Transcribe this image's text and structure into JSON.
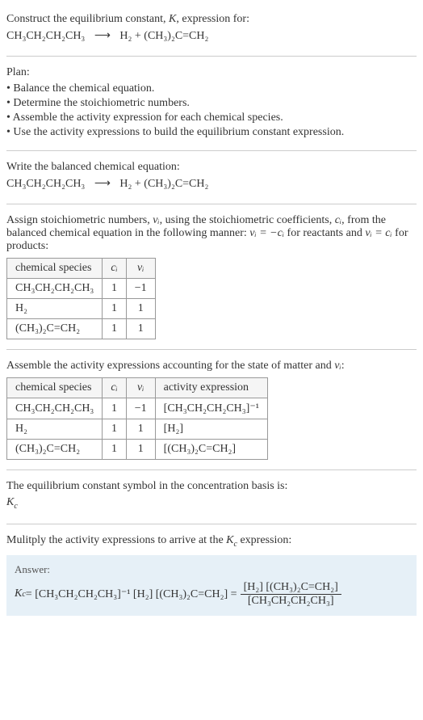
{
  "title_line1": "Construct the equilibrium constant, ",
  "title_K": "K",
  "title_line1_end": ", expression for:",
  "main_reaction_lhs": "CH₃CH₂CH₂CH₃",
  "arrow": "⟶",
  "main_reaction_rhs": "H₂ + (CH₃)₂C=CH₂",
  "plan_label": "Plan:",
  "plan_items": [
    "• Balance the chemical equation.",
    "• Determine the stoichiometric numbers.",
    "• Assemble the activity expression for each chemical species.",
    "• Use the activity expressions to build the equilibrium constant expression."
  ],
  "balanced_label": "Write the balanced chemical equation:",
  "stoich_text1": "Assign stoichiometric numbers, ",
  "nu_i": "νᵢ",
  "stoich_text2": ", using the stoichiometric coefficients, ",
  "c_i": "cᵢ",
  "stoich_text3": ", from the balanced chemical equation in the following manner: ",
  "stoich_rel1": "νᵢ = −cᵢ",
  "stoich_text4": " for reactants and ",
  "stoich_rel2": "νᵢ = cᵢ",
  "stoich_text5": " for products:",
  "table1_headers": [
    "chemical species",
    "cᵢ",
    "νᵢ"
  ],
  "table1_rows": [
    [
      "CH₃CH₂CH₂CH₃",
      "1",
      "−1"
    ],
    [
      "H₂",
      "1",
      "1"
    ],
    [
      "(CH₃)₂C=CH₂",
      "1",
      "1"
    ]
  ],
  "assemble_text1": "Assemble the activity expressions accounting for the state of matter and ",
  "assemble_text2": ":",
  "table2_headers": [
    "chemical species",
    "cᵢ",
    "νᵢ",
    "activity expression"
  ],
  "table2_rows": [
    [
      "CH₃CH₂CH₂CH₃",
      "1",
      "−1",
      "[CH₃CH₂CH₂CH₃]⁻¹"
    ],
    [
      "H₂",
      "1",
      "1",
      "[H₂]"
    ],
    [
      "(CH₃)₂C=CH₂",
      "1",
      "1",
      "[(CH₃)₂C=CH₂]"
    ]
  ],
  "symbol_text": "The equilibrium constant symbol in the concentration basis is:",
  "Kc": "K",
  "Kc_sub": "c",
  "multiply_text1": "Mulitply the activity expressions to arrive at the ",
  "multiply_text2": " expression:",
  "answer_label": "Answer:",
  "answer_lhs": "K",
  "answer_eq": " = [CH₃CH₂CH₂CH₃]⁻¹ [H₂] [(CH₃)₂C=CH₂] = ",
  "answer_num": "[H₂] [(CH₃)₂C=CH₂]",
  "answer_den": "[CH₃CH₂CH₂CH₃]"
}
